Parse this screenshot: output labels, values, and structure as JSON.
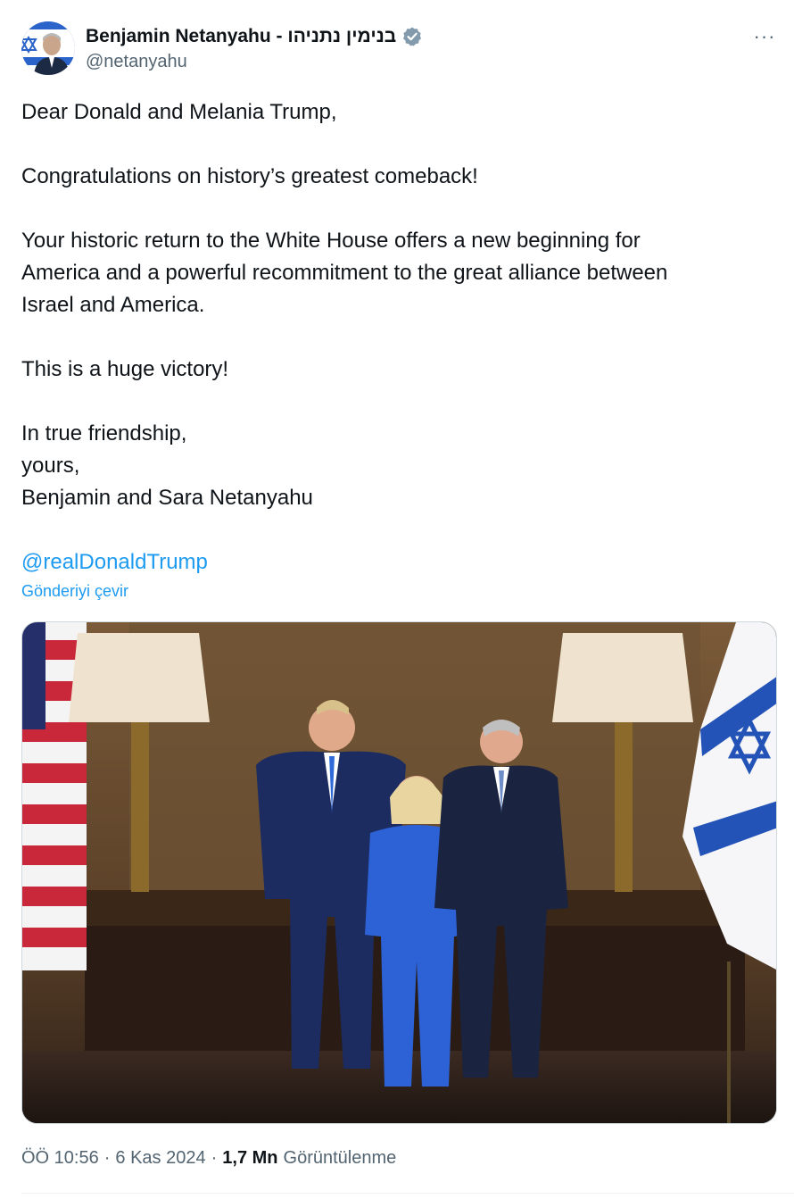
{
  "author": {
    "display_name": "Benjamin Netanyahu - בנימין נתניהו",
    "handle": "@netanyahu",
    "verified": true,
    "avatar_icon": "person-avatar-with-israeli-flag"
  },
  "menu": {
    "more_icon": "···"
  },
  "tweet": {
    "paragraphs": [
      [
        "Dear Donald and Melania Trump,"
      ],
      [
        "Congratulations on history’s greatest comeback!"
      ],
      [
        "Your historic return to the White House offers a new beginning for",
        "America and a powerful recommitment to the great alliance between",
        "Israel and America."
      ],
      [
        "This is a huge victory!"
      ],
      [
        "In true friendship,",
        "yours,",
        "Benjamin and Sara Netanyahu"
      ]
    ],
    "mention": "@realDonaldTrump",
    "translate_label": "Gönderiyi çevir"
  },
  "media": {
    "alt": "photo"
  },
  "meta": {
    "time": "ÖÖ 10:56",
    "date": "6 Kas 2024",
    "views_count": "1,7 Mn",
    "views_label": "Görüntülenme"
  },
  "colors": {
    "link": "#1d9bf0",
    "text": "#0f1419",
    "secondary": "#536471",
    "verified_badge": "#829aab"
  }
}
